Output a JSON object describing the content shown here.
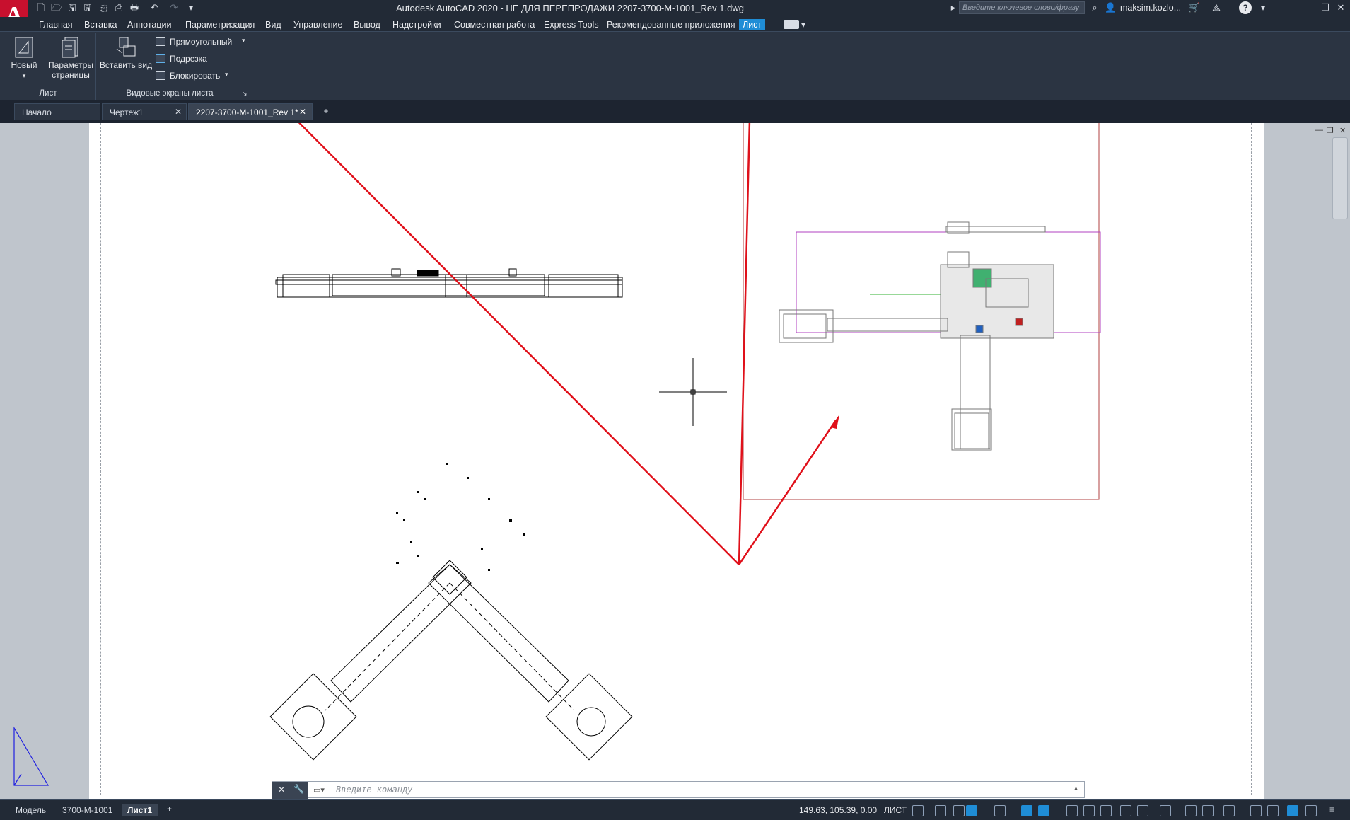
{
  "window": {
    "title": "Autodesk AutoCAD 2020 - НЕ ДЛЯ ПЕРЕПРОДАЖИ    2207-3700-M-1001_Rev 1.dwg",
    "search_placeholder": "Введите ключевое слово/фразу",
    "user": "maksim.kozlo...",
    "help": "?"
  },
  "menu": {
    "items": [
      "Главная",
      "Вставка",
      "Аннотации",
      "Параметризация",
      "Вид",
      "Управление",
      "Вывод",
      "Надстройки",
      "Совместная работа",
      "Express Tools",
      "Рекомендованные приложения",
      "Лист"
    ],
    "active": "Лист"
  },
  "ribbon": {
    "new_label": "Новый",
    "page_setup_label_1": "Параметры",
    "page_setup_label_2": "страницы",
    "insert_view_label": "Вставить вид",
    "rectangular_label": "Прямоугольный",
    "clip_label": "Подрезка",
    "lock_label": "Блокировать",
    "panel_layout": "Лист",
    "panel_viewports": "Видовые экраны листа"
  },
  "tabs": {
    "start": "Начало",
    "drawing1": "Чертеж1",
    "current": "2207-3700-M-1001_Rev 1*"
  },
  "command": {
    "placeholder": "Введите команду"
  },
  "status": {
    "model_tab": "Модель",
    "layout_tab_1": "3700-M-1001",
    "layout_tab_2": "Лист1",
    "coords": "149.63, 105.39, 0.00",
    "space": "ЛИСТ"
  },
  "colors": {
    "accent": "#1f8dd6",
    "annotation_arrow": "#e0101a",
    "viewport_border": "#b04040",
    "magenta_line": "#b040c0"
  }
}
